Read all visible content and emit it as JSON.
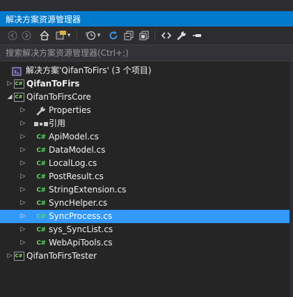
{
  "window": {
    "title": "解决方案资源管理器"
  },
  "toolbar": {
    "buttons": [
      {
        "name": "back-icon",
        "glyph": "◀"
      },
      {
        "name": "forward-icon",
        "glyph": "▶"
      },
      {
        "name": "home-icon",
        "glyph": "⌂"
      },
      {
        "name": "switch-views-icon",
        "glyph": "▦"
      },
      {
        "name": "dropdown-icon",
        "glyph": "▾"
      },
      {
        "name": "pending-changes-icon",
        "glyph": "⏲"
      },
      {
        "name": "dropdown-icon",
        "glyph": "▾"
      },
      {
        "name": "refresh-icon",
        "glyph": "↻"
      },
      {
        "name": "collapse-all-icon",
        "glyph": "▣"
      },
      {
        "name": "show-all-files-icon",
        "glyph": "⧉"
      },
      {
        "name": "view-code-icon",
        "glyph": "‹›"
      },
      {
        "name": "properties-wrench-icon",
        "glyph": "🔧"
      },
      {
        "name": "pin-icon",
        "glyph": "━"
      }
    ]
  },
  "search": {
    "placeholder": "搜索解决方案资源管理器(Ctrl+;)"
  },
  "tree": [
    {
      "label": "解决方案'QifanToFirs' (3 个项目)",
      "level": 0,
      "icon": "solution-icon",
      "arrow": "",
      "bold": false,
      "selected": false
    },
    {
      "label": "QifanToFirs",
      "level": 0,
      "icon": "csharp-project-icon",
      "arrow": "collapsed",
      "bold": true,
      "selected": false
    },
    {
      "label": "QifanToFirsCore",
      "level": 0,
      "icon": "csharp-project-icon",
      "arrow": "expanded",
      "bold": false,
      "selected": false
    },
    {
      "label": "Properties",
      "level": 1,
      "icon": "wrench-icon",
      "arrow": "collapsed",
      "bold": false,
      "selected": false
    },
    {
      "label": "引用",
      "level": 1,
      "icon": "references-icon",
      "arrow": "collapsed",
      "bold": false,
      "selected": false
    },
    {
      "label": "ApiModel.cs",
      "level": 1,
      "icon": "csharp-file-icon",
      "arrow": "collapsed",
      "bold": false,
      "selected": false
    },
    {
      "label": "DataModel.cs",
      "level": 1,
      "icon": "csharp-file-icon",
      "arrow": "collapsed",
      "bold": false,
      "selected": false
    },
    {
      "label": "LocalLog.cs",
      "level": 1,
      "icon": "csharp-file-icon",
      "arrow": "collapsed",
      "bold": false,
      "selected": false
    },
    {
      "label": "PostResult.cs",
      "level": 1,
      "icon": "csharp-file-icon",
      "arrow": "collapsed",
      "bold": false,
      "selected": false
    },
    {
      "label": "StringExtension.cs",
      "level": 1,
      "icon": "csharp-file-icon",
      "arrow": "collapsed",
      "bold": false,
      "selected": false
    },
    {
      "label": "SyncHelper.cs",
      "level": 1,
      "icon": "csharp-file-icon",
      "arrow": "collapsed",
      "bold": false,
      "selected": false
    },
    {
      "label": "SyncProcess.cs",
      "level": 1,
      "icon": "csharp-file-icon",
      "arrow": "collapsed",
      "bold": false,
      "selected": true
    },
    {
      "label": "sys_SyncList.cs",
      "level": 1,
      "icon": "csharp-file-icon",
      "arrow": "collapsed",
      "bold": false,
      "selected": false
    },
    {
      "label": "WebApiTools.cs",
      "level": 1,
      "icon": "csharp-file-icon",
      "arrow": "collapsed",
      "bold": false,
      "selected": false
    },
    {
      "label": "QifanToFirsTester",
      "level": 0,
      "icon": "csharp-project-icon",
      "arrow": "collapsed",
      "bold": false,
      "selected": false
    }
  ],
  "glyphs": {
    "csharp": "C#"
  },
  "colors": {
    "accent": "#007acc",
    "selection": "#3399ff",
    "background": "#252526"
  }
}
